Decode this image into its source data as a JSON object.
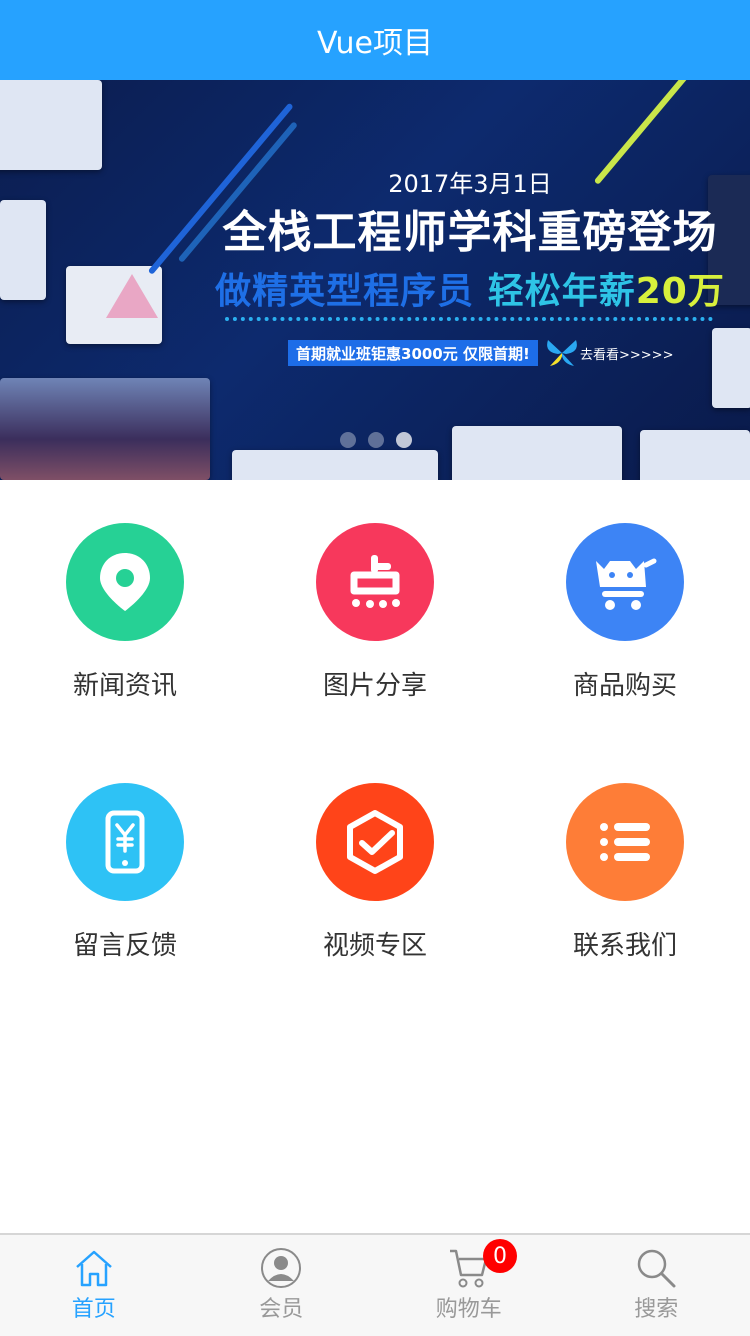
{
  "header": {
    "title": "Vue项目"
  },
  "banner": {
    "date": "2017年3月1日",
    "title": "全栈工程师学科重磅登场",
    "subtitle_part1": "做精英型程序员",
    "subtitle_part2": "轻松年薪",
    "subtitle_part3": "20万",
    "promo": "首期就业班钜惠3000元 仅限首期!",
    "cta": "去看看>>>>>",
    "slides_total": 3,
    "slide_active_index": 3
  },
  "grid": {
    "items": [
      {
        "label": "新闻资讯",
        "icon": "location-pin-icon",
        "color": "#26d195"
      },
      {
        "label": "图片分享",
        "icon": "dianping-icon",
        "color": "#f7385c"
      },
      {
        "label": "商品购买",
        "icon": "cat-cart-icon",
        "color": "#3d84f5"
      },
      {
        "label": "留言反馈",
        "icon": "phone-yuan-icon",
        "color": "#2ec2f5"
      },
      {
        "label": "视频专区",
        "icon": "hexagon-check-icon",
        "color": "#ff4419"
      },
      {
        "label": "联系我们",
        "icon": "list-icon",
        "color": "#fe7d37"
      }
    ]
  },
  "tabbar": {
    "items": [
      {
        "label": "首页",
        "icon": "home-icon",
        "active": true
      },
      {
        "label": "会员",
        "icon": "user-icon",
        "active": false
      },
      {
        "label": "购物车",
        "icon": "cart-icon",
        "active": false,
        "badge": "0"
      },
      {
        "label": "搜索",
        "icon": "search-icon",
        "active": false
      }
    ]
  },
  "colors": {
    "primary": "#26a2ff",
    "badge": "#ff0000",
    "inactive": "#999999"
  }
}
